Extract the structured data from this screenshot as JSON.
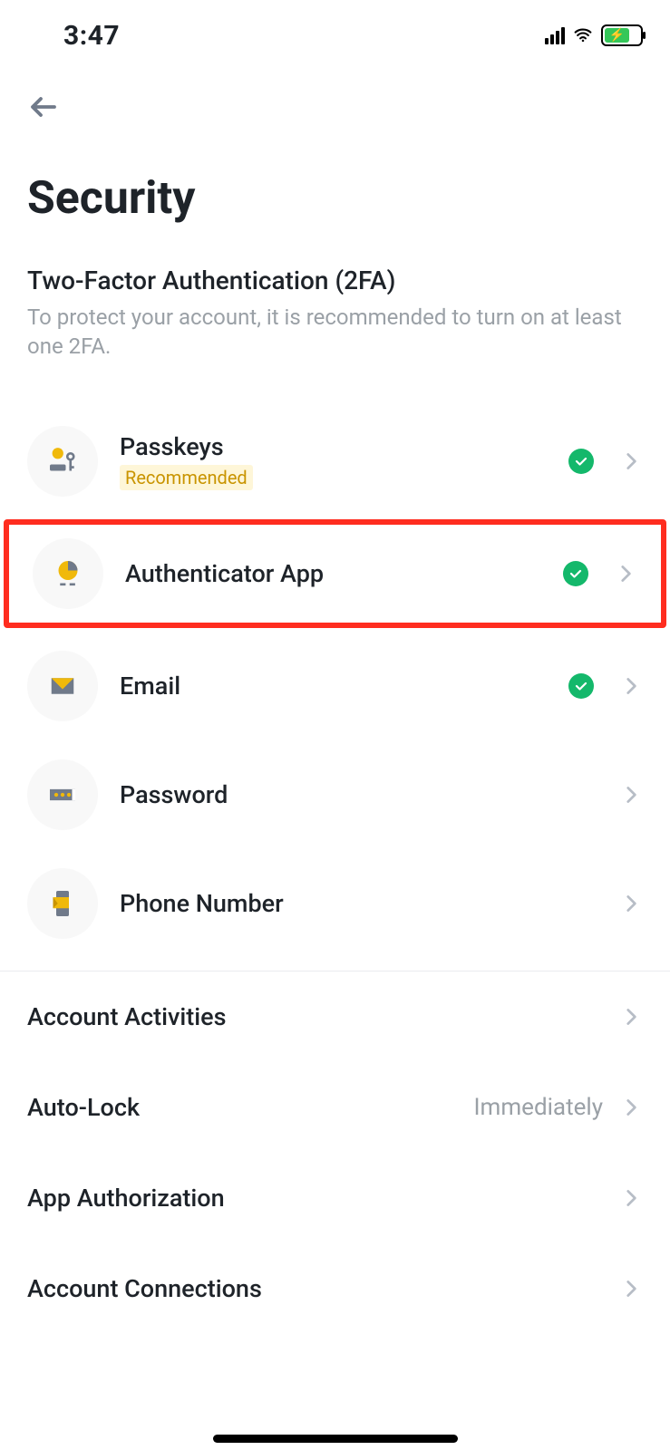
{
  "status": {
    "time": "3:47"
  },
  "page": {
    "title": "Security"
  },
  "sections": {
    "twofa": {
      "title": "Two-Factor Authentication (2FA)",
      "description": "To protect your account, it is recommended to turn on at least one 2FA."
    }
  },
  "twofa_items": {
    "passkeys": {
      "label": "Passkeys",
      "badge": "Recommended",
      "enabled": true
    },
    "authenticator": {
      "label": "Authenticator App",
      "enabled": true
    },
    "email": {
      "label": "Email",
      "enabled": true
    },
    "password": {
      "label": "Password",
      "enabled": false
    },
    "phone": {
      "label": "Phone Number",
      "enabled": false
    }
  },
  "rows": {
    "activities": {
      "label": "Account Activities"
    },
    "autolock": {
      "label": "Auto-Lock",
      "value": "Immediately"
    },
    "authorization": {
      "label": "App Authorization"
    },
    "connections": {
      "label": "Account Connections"
    }
  }
}
